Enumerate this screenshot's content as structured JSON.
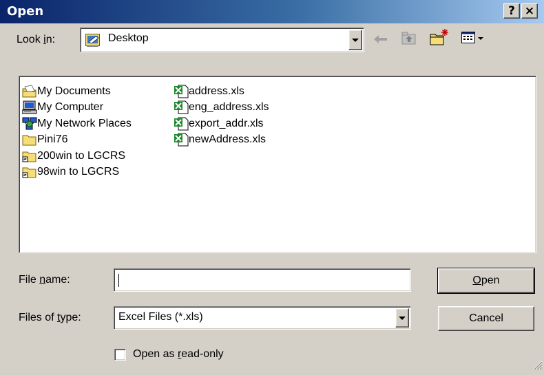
{
  "window": {
    "title": "Open",
    "help_label": "?",
    "close_label": "×"
  },
  "lookin": {
    "label_pre": "Look ",
    "label_key": "i",
    "label_post": "n:",
    "value": "Desktop",
    "icons": [
      "folder-desktop-icon",
      "back-arrow-icon",
      "up-folder-icon",
      "new-folder-icon",
      "view-menu-icon"
    ]
  },
  "files": {
    "col1": [
      {
        "name": "My Documents",
        "icon": "my-documents-icon"
      },
      {
        "name": "My Computer",
        "icon": "my-computer-icon"
      },
      {
        "name": "My Network Places",
        "icon": "network-places-icon"
      },
      {
        "name": "Pini76",
        "icon": "folder-icon"
      },
      {
        "name": "200win to LGCRS",
        "icon": "shortcut-folder-icon"
      },
      {
        "name": "98win to LGCRS",
        "icon": "shortcut-folder-icon"
      }
    ],
    "col2": [
      {
        "name": "address.xls",
        "icon": "excel-file-icon"
      },
      {
        "name": "eng_address.xls",
        "icon": "excel-file-icon"
      },
      {
        "name": "export_addr.xls",
        "icon": "excel-file-icon"
      },
      {
        "name": "newAddress.xls",
        "icon": "excel-file-icon"
      }
    ]
  },
  "filename": {
    "label_pre": "File ",
    "label_key": "n",
    "label_post": "ame:",
    "value": ""
  },
  "filetype": {
    "label_pre": "Files of ",
    "label_key": "t",
    "label_post": "ype:",
    "value": "Excel Files (*.xls)"
  },
  "buttons": {
    "open_key": "O",
    "open_rest": "pen",
    "cancel": "Cancel"
  },
  "readonly": {
    "label_pre": "Open as ",
    "label_key": "r",
    "label_post": "ead-only",
    "checked": false
  },
  "colors": {
    "title_start": "#0a246a",
    "title_end": "#a6caf0",
    "face": "#d4d0c8",
    "excel_green": "#1e8a2e"
  }
}
